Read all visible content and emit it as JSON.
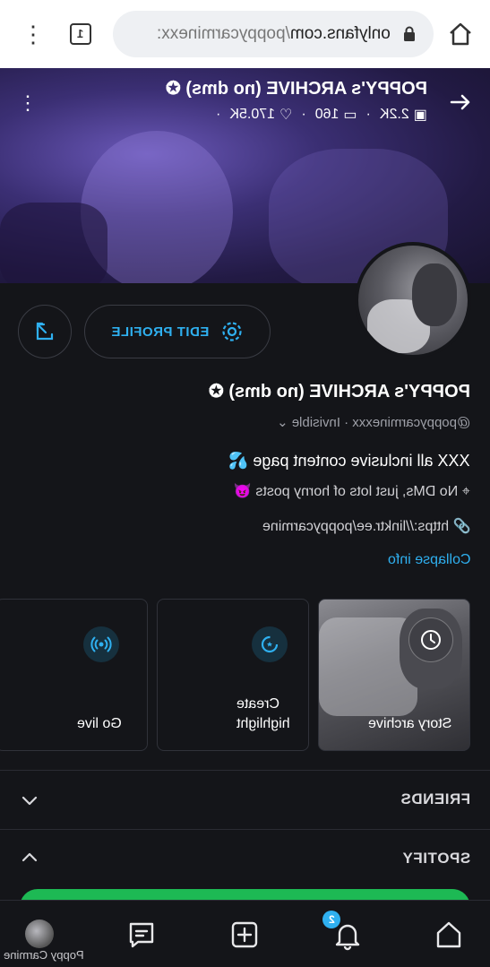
{
  "browser": {
    "url_domain": "onlyfans.com",
    "url_path": "/poppycarminexx:",
    "tab_count": "1"
  },
  "cover": {
    "title": "POPPY's ARCHIVE (no dms)",
    "stats": {
      "photos": "2.2K",
      "videos": "160",
      "likes": "170.5K"
    }
  },
  "profile": {
    "edit_label": "EDIT PROFILE",
    "name": "POPPY's ARCHIVE (no dms)",
    "handle": "@poppycarminexxx",
    "status": "Invisible",
    "bio_line1": "XXX all inclusive content page 💦",
    "bio_line2": "No DMs, just lots of horny posts 😈",
    "link": "https://linktr.ee/poppycarmine",
    "collapse_label": "Collapse info"
  },
  "cards": {
    "archive_label": "Story archive",
    "highlight_label_1": "Create",
    "highlight_label_2": "highlight",
    "golive_label": "Go live"
  },
  "sections": {
    "friends": "FRIENDS",
    "spotify": "SPOTIFY"
  },
  "bottom_nav": {
    "notifications_badge": "2",
    "user_name": "Poppy Carmine"
  },
  "colors": {
    "accent": "#2fb0f0",
    "spotify": "#1db954",
    "background": "#141519"
  }
}
